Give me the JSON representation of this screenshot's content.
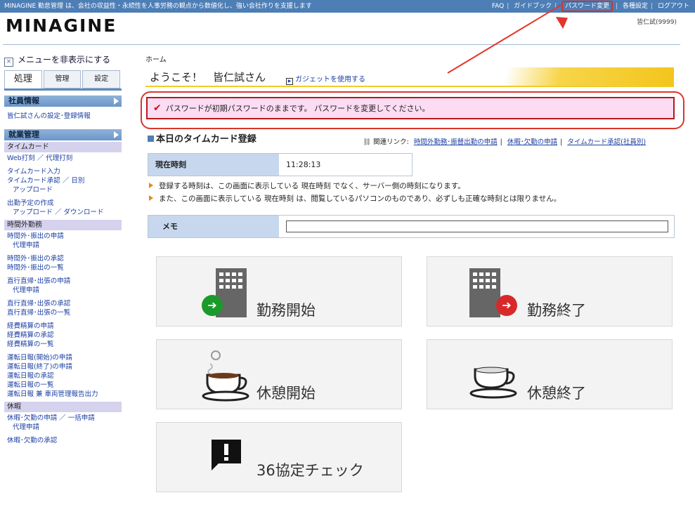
{
  "topbar": {
    "tagline": "MINAGINE 勤怠管理 は、会社の収益性・永続性を人事労務の観点から数値化し、強い会社作りを支援します",
    "links": [
      "FAQ",
      "ガイドブック",
      "パスワード変更",
      "各種設定",
      "ログアウト"
    ]
  },
  "header": {
    "logo": "MINAGINE",
    "user": "皆仁試(9999)"
  },
  "sidebar": {
    "hide_menu": "メニューを非表示にする",
    "tabs": [
      "処理",
      "管理",
      "設定"
    ],
    "employee_info": "社員情報",
    "employee_link": "皆仁試さんの設定･登録情報",
    "work_mgmt": "就業管理",
    "timecard": "タイムカード",
    "tc_links": [
      "Web打刻 ／ 代理打刻",
      "タイムカード入力",
      "タイムカード承認 ／ 日別",
      "アップロード",
      "出勤予定の作成",
      "アップロード ／ ダウンロード"
    ],
    "overtime": "時間外勤務",
    "ot_links": [
      "時間外･振出の申請",
      "代理申請",
      "時間外･振出の承認",
      "時間外･振出の一覧",
      "直行直帰･出張の申請",
      "代理申請",
      "直行直帰･出張の承認",
      "直行直帰･出張の一覧",
      "経費精算の申請",
      "経費精算の承認",
      "経費精算の一覧",
      "運転日報(開始)の申請",
      "運転日報(終了)の申請",
      "運転日報の承認",
      "運転日報の一覧",
      "運転日報 兼 車両管理報告出力"
    ],
    "leave": "休暇",
    "leave_links": [
      "休暇･欠勤の申請 ／ 一括申請",
      "代理申請",
      "休暇･欠勤の承認"
    ]
  },
  "main": {
    "breadcrumb": "ホーム",
    "welcome": "ようこそ！　皆仁試さん",
    "gadget": "ガジェットを使用する",
    "alert": "パスワードが初期パスワードのままです。 パスワードを変更してください。",
    "timecard_title": "本日のタイムカード登録",
    "related_label": "関連リンク:",
    "related_links": [
      "時間外勤務･振替出勤の申請",
      "休暇･欠勤の申請",
      "タイムカード承認(社員別)"
    ],
    "current_time_label": "現在時刻",
    "current_time": "11:28:13",
    "notes": [
      "登録する時刻は、この画面に表示している 現在時刻 でなく、サーバー側の時刻になります。",
      "また、この画面に表示している 現在時刻 は、閲覧しているパソコンのものであり、必ずしも正確な時刻とは限りません。"
    ],
    "memo_label": "メモ",
    "memo_value": "",
    "buttons": {
      "work_start": "勤務開始",
      "work_end": "勤務終了",
      "break_start": "休憩開始",
      "break_end": "休憩終了",
      "check36": "36協定チェック"
    }
  }
}
